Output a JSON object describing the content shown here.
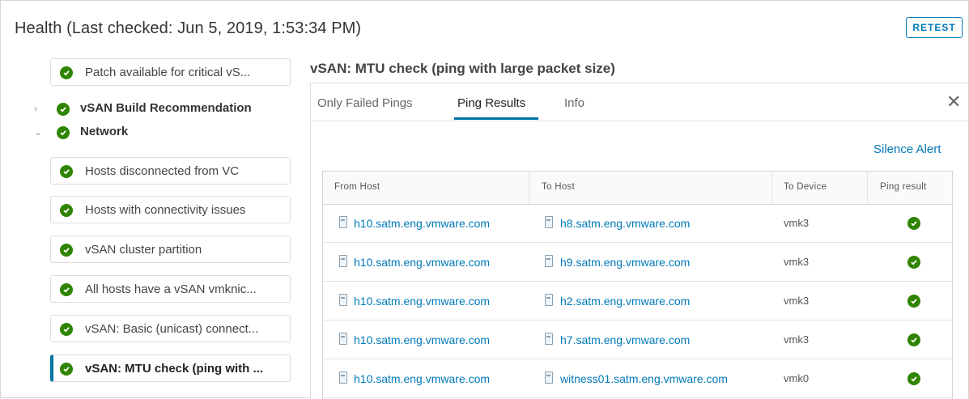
{
  "header": {
    "title": "Health (Last checked: Jun 5, 2019, 1:53:34 PM)",
    "retest_label": "RETEST"
  },
  "tree": {
    "patch_item": "Patch available for critical vS...",
    "build_node": "vSAN Build Recommendation",
    "network_node": "Network",
    "network_items": [
      "Hosts disconnected from VC",
      "Hosts with connectivity issues",
      "vSAN cluster partition",
      "All hosts have a vSAN vmknic...",
      "vSAN: Basic (unicast) connect...",
      "vSAN: MTU check (ping with ..."
    ],
    "selected_index": 5,
    "status": "passed"
  },
  "detail": {
    "title": "vSAN: MTU check (ping with large packet size)",
    "tabs": [
      "Only Failed Pings",
      "Ping Results",
      "Info"
    ],
    "active_tab": "Ping Results",
    "silence_alert": "Silence Alert",
    "columns": [
      "From Host",
      "To Host",
      "To Device",
      "Ping result"
    ],
    "rows": [
      {
        "from": "h10.satm.eng.vmware.com",
        "to": "h8.satm.eng.vmware.com",
        "device": "vmk3",
        "result": "success"
      },
      {
        "from": "h10.satm.eng.vmware.com",
        "to": "h9.satm.eng.vmware.com",
        "device": "vmk3",
        "result": "success"
      },
      {
        "from": "h10.satm.eng.vmware.com",
        "to": "h2.satm.eng.vmware.com",
        "device": "vmk3",
        "result": "success"
      },
      {
        "from": "h10.satm.eng.vmware.com",
        "to": "h7.satm.eng.vmware.com",
        "device": "vmk3",
        "result": "success"
      },
      {
        "from": "h10.satm.eng.vmware.com",
        "to": "witness01.satm.eng.vmware.com",
        "device": "vmk0",
        "result": "success"
      }
    ]
  },
  "colors": {
    "accent": "#0079b8",
    "success": "#2f8400",
    "border": "#dddddd"
  },
  "icons": {
    "status": "check-circle-icon",
    "expand": "chevron-right-icon",
    "collapse": "chevron-down-icon",
    "host": "host-icon",
    "close": "close-icon"
  }
}
